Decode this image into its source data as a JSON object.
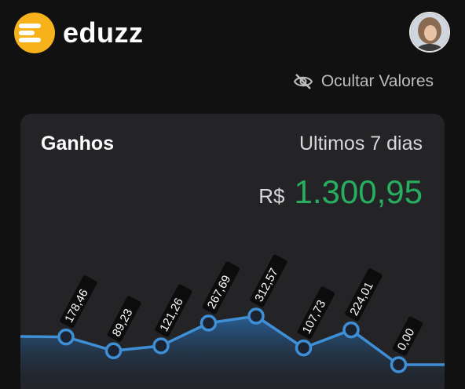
{
  "brand": {
    "name": "eduzz",
    "accent": "#f7b21b"
  },
  "header": {
    "hide_values_label": "Ocultar Valores",
    "hide_values_icon": "eye-off-icon"
  },
  "earnings": {
    "title": "Ganhos",
    "period": "Ultimos 7 dias",
    "currency": "R$",
    "total": "1.300,95",
    "total_color": "#27ae60"
  },
  "chart_data": {
    "type": "area",
    "values": [
      178.46,
      89.23,
      121.26,
      267.69,
      312.57,
      107.73,
      224.01,
      0.0
    ],
    "labels": [
      "178,46",
      "89,23",
      "121,26",
      "267,69",
      "312,57",
      "107,73",
      "224,01",
      "0,00"
    ],
    "title": "",
    "xlabel": "",
    "ylabel": "",
    "line_color": "#3f8fd6"
  }
}
